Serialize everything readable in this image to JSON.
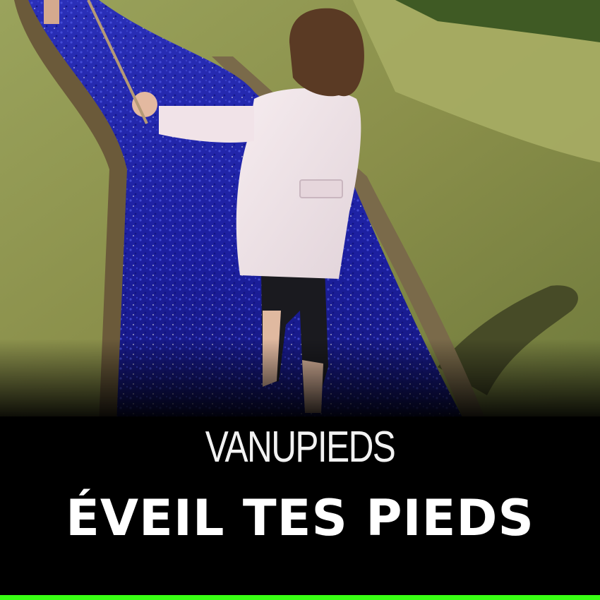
{
  "brand_name": "VANUPIEDS",
  "headline": "ÉVEIL TES PIEDS",
  "colors": {
    "banner": "#000000",
    "accent": "#39ff14",
    "glass_path": "#1c1fa8",
    "grass": "#8a9a4e"
  }
}
